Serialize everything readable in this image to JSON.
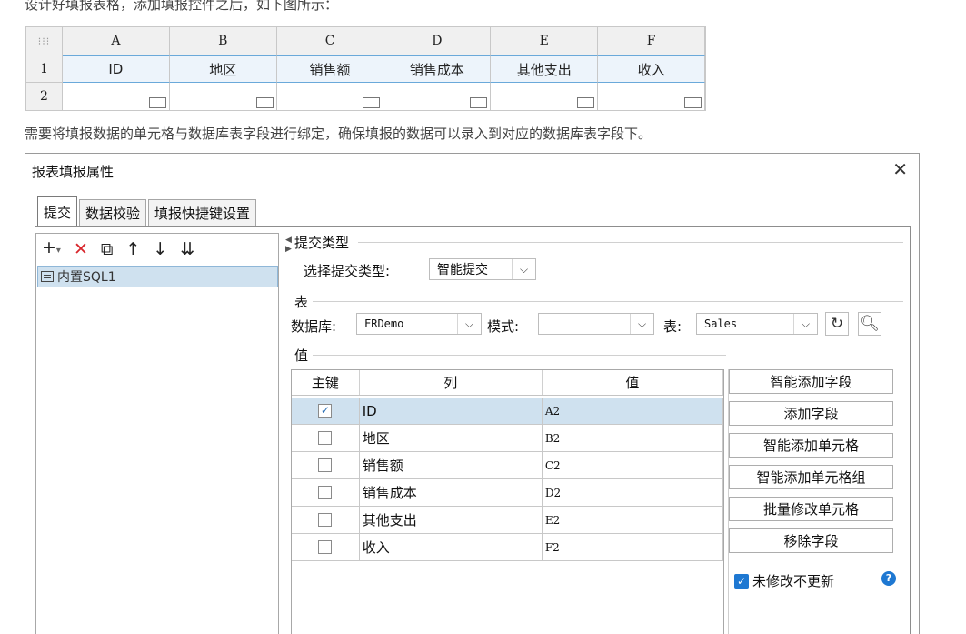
{
  "doc": {
    "intro": "设计好填报表格，添加填报控件之后，如下图所示：",
    "para": "需要将填报数据的单元格与数据库表字段进行绑定，确保填报的数据可以录入到对应的数据库表字段下。"
  },
  "sheet": {
    "corner": "⁝⁝⁝",
    "columns": [
      "A",
      "B",
      "C",
      "D",
      "E",
      "F"
    ],
    "rows": [
      "1",
      "2"
    ],
    "header_cells": [
      "ID",
      "地区",
      "销售额",
      "销售成本",
      "其他支出",
      "收入"
    ]
  },
  "dialog": {
    "title": "报表填报属性",
    "close": "✕",
    "tabs": [
      "提交",
      "数据校验",
      "填报快捷键设置"
    ],
    "toolbar": {
      "add": "+",
      "add_caret": "▾",
      "delete": "✕",
      "copy": "⧉",
      "up": "↑",
      "down": "↓",
      "sort": "⇊"
    },
    "list_items": [
      "内置SQL1"
    ],
    "submit_type_section": "提交类型",
    "submit_type_label": "选择提交类型:",
    "submit_type_value": "智能提交",
    "table_section": "表",
    "db_label": "数据库:",
    "db_value": "FRDemo",
    "schema_label": "模式:",
    "schema_value": "",
    "table_label": "表:",
    "table_value": "Sales",
    "value_section": "值",
    "grid_headers": {
      "key": "主键",
      "column": "列",
      "value": "值"
    },
    "grid_rows": [
      {
        "key": true,
        "column": "ID",
        "value": "A2"
      },
      {
        "key": false,
        "column": "地区",
        "value": "B2"
      },
      {
        "key": false,
        "column": "销售额",
        "value": "C2"
      },
      {
        "key": false,
        "column": "销售成本",
        "value": "D2"
      },
      {
        "key": false,
        "column": "其他支出",
        "value": "E2"
      },
      {
        "key": false,
        "column": "收入",
        "value": "F2"
      }
    ],
    "buttons": [
      "智能添加字段",
      "添加字段",
      "智能添加单元格",
      "智能添加单元格组",
      "批量修改单元格",
      "移除字段"
    ],
    "no_update_label": "未修改不更新",
    "no_update_checked": true,
    "help": "?"
  }
}
